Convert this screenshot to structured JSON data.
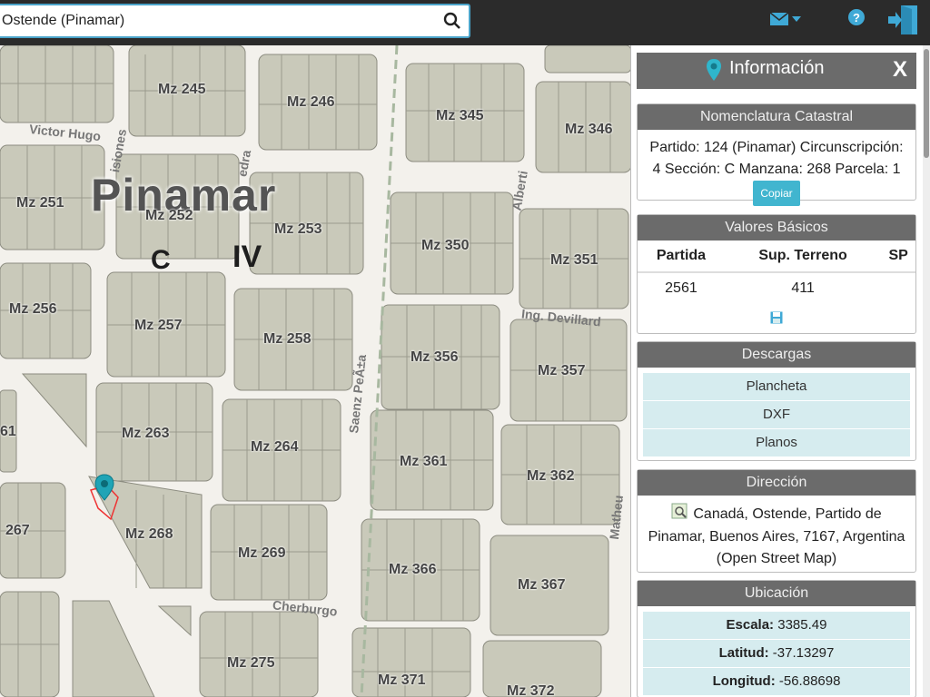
{
  "search": {
    "value": "Ostende (Pinamar)"
  },
  "map": {
    "town": "Pinamar",
    "circ_letter": "C",
    "circ_roman": "IV",
    "manzanas": [
      {
        "label": "Mz 245"
      },
      {
        "label": "Mz 246"
      },
      {
        "label": "Mz 345"
      },
      {
        "label": "Mz 346"
      },
      {
        "label": "Mz 251"
      },
      {
        "label": "Mz 252"
      },
      {
        "label": "Mz 253"
      },
      {
        "label": "Mz 350"
      },
      {
        "label": "Mz 351"
      },
      {
        "label": "Mz 256"
      },
      {
        "label": "Mz 257"
      },
      {
        "label": "Mz 258"
      },
      {
        "label": "Mz 356"
      },
      {
        "label": "Mz 357"
      },
      {
        "label": "Mz 263"
      },
      {
        "label": "Mz 264"
      },
      {
        "label": "Mz 361"
      },
      {
        "label": "Mz 362"
      },
      {
        "label": "267"
      },
      {
        "label": "Mz 268"
      },
      {
        "label": "Mz 269"
      },
      {
        "label": "Mz 366"
      },
      {
        "label": "Mz 367"
      },
      {
        "label": "Mz 275"
      },
      {
        "label": "Mz 371"
      },
      {
        "label": "Mz 372"
      },
      {
        "label": "61"
      }
    ],
    "streets": [
      {
        "label": "Victor Hugo"
      },
      {
        "label": "isiones"
      },
      {
        "label": "edra"
      },
      {
        "label": "Alberti"
      },
      {
        "label": "Ing. Devillard"
      },
      {
        "label": "Saenz PeÃ±a"
      },
      {
        "label": "Matheu"
      },
      {
        "label": "Cherburgo"
      }
    ]
  },
  "panel": {
    "title": "Información",
    "close": "X",
    "nomenclatura": {
      "header": "Nomenclatura Catastral",
      "line1": "Partido: 124 (Pinamar) Circunscripción:",
      "line2": "4 Sección: C Manzana: 268 Parcela: 1",
      "copy_label": "Copiar"
    },
    "valores": {
      "header": "Valores Básicos",
      "columns": [
        "Partida",
        "Sup. Terreno",
        "SP"
      ],
      "row": [
        "2561",
        "411",
        ""
      ]
    },
    "descargas": {
      "header": "Descargas",
      "items": [
        "Plancheta",
        "DXF",
        "Planos"
      ]
    },
    "direccion": {
      "header": "Dirección",
      "line1": "Canadá, Ostende, Partido de",
      "line2": "Pinamar, Buenos Aires, 7167, Argentina",
      "line3": "(Open Street Map)"
    },
    "ubicacion": {
      "header": "Ubicación",
      "rows": [
        {
          "label": "Escala:",
          "value": "3385.49"
        },
        {
          "label": "Latitud:",
          "value": "-37.13297"
        },
        {
          "label": "Longitud:",
          "value": "-56.88698"
        }
      ]
    }
  },
  "colors": {
    "header_bg": "#2b2b2b",
    "accent": "#41b5cf",
    "panel_header": "#6b6b6b",
    "block": "#c9c9ba"
  }
}
